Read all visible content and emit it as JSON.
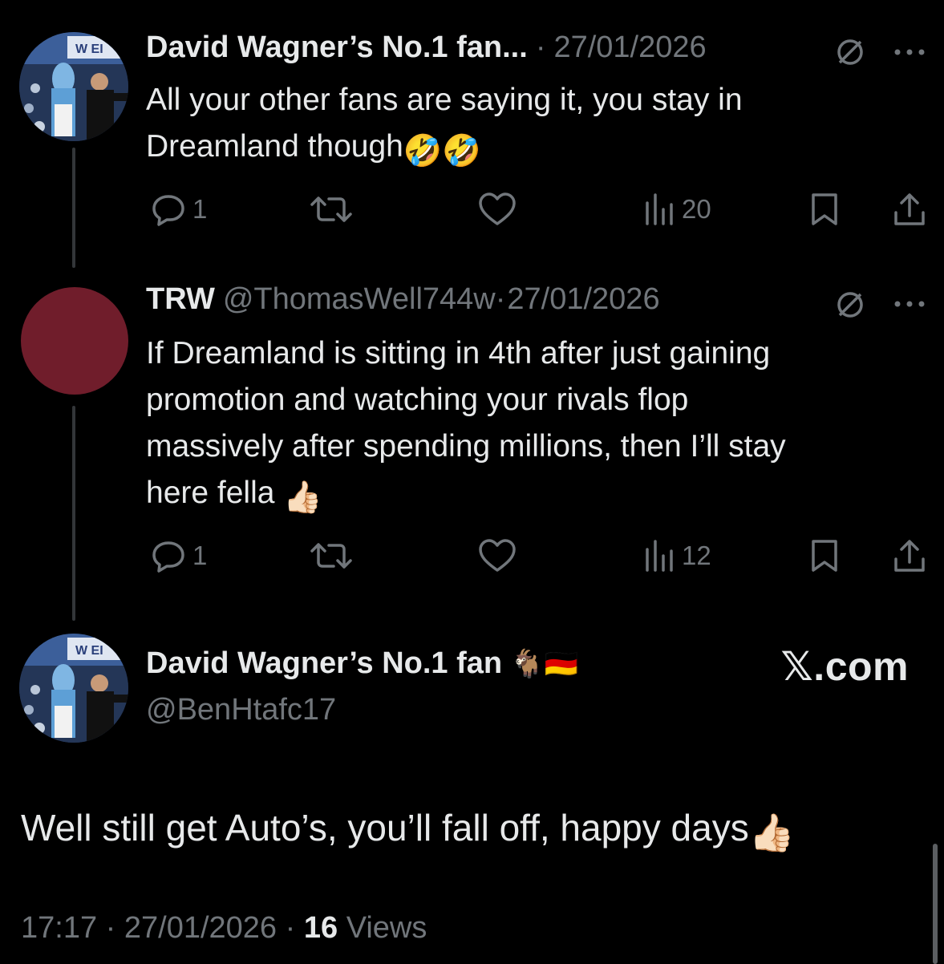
{
  "tweets": [
    {
      "display_name": "David Wagner’s No.1 fan...",
      "handle": "",
      "separator": "·",
      "date": "27/01/2026",
      "text": "All your other fans are saying it, you stay in\nDreamland though",
      "trailing_emoji": "🤣🤣",
      "replies": "1",
      "views": "20"
    },
    {
      "display_name": "TRW",
      "handle": "@ThomasWell744w",
      "separator": "·",
      "date": "27/01/2026",
      "text": "If Dreamland is sitting in 4th after just gaining\npromotion and watching your rivals flop\nmassively after spending millions, then I’ll stay\nhere fella",
      "trailing_emoji": "👍🏻",
      "replies": "1",
      "views": "12"
    }
  ],
  "main_tweet": {
    "display_name": "David Wagner’s No.1 fan",
    "name_emoji": "🐐🇩🇪",
    "handle": "@BenHtafc17",
    "text": "Well still get Auto’s, you’ll fall off, happy days",
    "trailing_emoji": "👍🏻",
    "time": "17:17",
    "separator": "·",
    "date": "27/01/2026",
    "views_count": "16",
    "views_label": "Views"
  },
  "watermark": "𝕏.com",
  "colors": {
    "background": "#000000",
    "text": "#e7e9ea",
    "secondary": "#71767b",
    "avatar_red": "#701d2b"
  },
  "icons": [
    "reply-icon",
    "retweet-icon",
    "like-icon",
    "views-icon",
    "bookmark-icon",
    "share-icon",
    "muted-icon",
    "more-icon"
  ]
}
